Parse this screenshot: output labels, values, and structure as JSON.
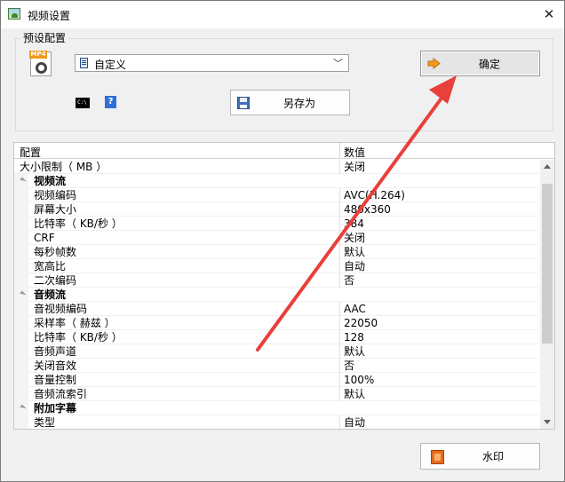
{
  "window": {
    "title": "视频设置",
    "close_glyph": "✕"
  },
  "preset": {
    "group_label": "预设配置",
    "format_badge": "MP4",
    "selected": "自定义",
    "confirm_label": "确定",
    "save_as_label": "另存为",
    "cmd_icon_text": "C:\\",
    "help_icon_text": "?"
  },
  "grid": {
    "col_name": "配置",
    "col_value": "数值",
    "rows": [
      {
        "kind": "top",
        "name": "大小限制（ MB ）",
        "value": "关闭"
      },
      {
        "kind": "cat",
        "name": "视频流",
        "value": ""
      },
      {
        "kind": "item",
        "name": "视频编码",
        "value": "AVC(H.264)"
      },
      {
        "kind": "item",
        "name": "屏幕大小",
        "value": "480x360"
      },
      {
        "kind": "item",
        "name": "比特率（ KB/秒 ）",
        "value": "384"
      },
      {
        "kind": "item",
        "name": "CRF",
        "value": "关闭"
      },
      {
        "kind": "item",
        "name": "每秒帧数",
        "value": "默认"
      },
      {
        "kind": "item",
        "name": "宽高比",
        "value": "自动"
      },
      {
        "kind": "item",
        "name": "二次编码",
        "value": "否"
      },
      {
        "kind": "cat",
        "name": "音频流",
        "value": ""
      },
      {
        "kind": "item",
        "name": "音视频编码",
        "value": "AAC"
      },
      {
        "kind": "item",
        "name": "采样率（ 赫兹 ）",
        "value": "22050"
      },
      {
        "kind": "item",
        "name": "比特率（ KB/秒 ）",
        "value": "128"
      },
      {
        "kind": "item",
        "name": "音频声道",
        "value": "默认"
      },
      {
        "kind": "item",
        "name": "关闭音效",
        "value": "否"
      },
      {
        "kind": "item",
        "name": "音量控制",
        "value": "100%"
      },
      {
        "kind": "item",
        "name": "音频流索引",
        "value": "默认"
      },
      {
        "kind": "cat",
        "name": "附加字幕",
        "value": ""
      },
      {
        "kind": "item",
        "name": "类型",
        "value": "自动"
      }
    ]
  },
  "watermark": {
    "label": "水印"
  },
  "colors": {
    "annotation_arrow": "#e8403a",
    "accent_orange": "#f29b1d"
  }
}
